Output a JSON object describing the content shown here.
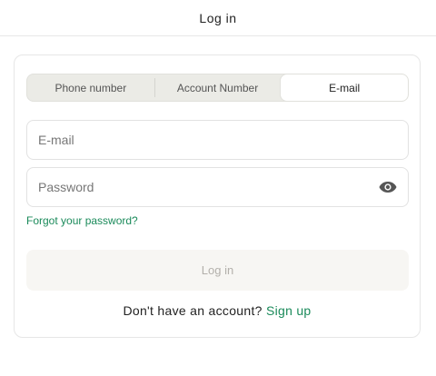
{
  "header": {
    "title": "Log in"
  },
  "tabs": [
    {
      "label": "Phone number",
      "active": false
    },
    {
      "label": "Account Number",
      "active": false
    },
    {
      "label": "E-mail",
      "active": true
    }
  ],
  "form": {
    "email_placeholder": "E-mail",
    "email_value": "",
    "password_placeholder": "Password",
    "password_value": "",
    "password_toggle_icon": "eye-icon",
    "forgot_label": "Forgot your password?",
    "login_label": "Log in"
  },
  "signup": {
    "prompt": "Don't have an account?",
    "link_label": "Sign up"
  },
  "colors": {
    "accent_green": "#1a8a5a",
    "tab_background": "#ebebe6",
    "disabled_button_bg": "#f7f6f3",
    "disabled_button_text": "#b3b0ab"
  }
}
